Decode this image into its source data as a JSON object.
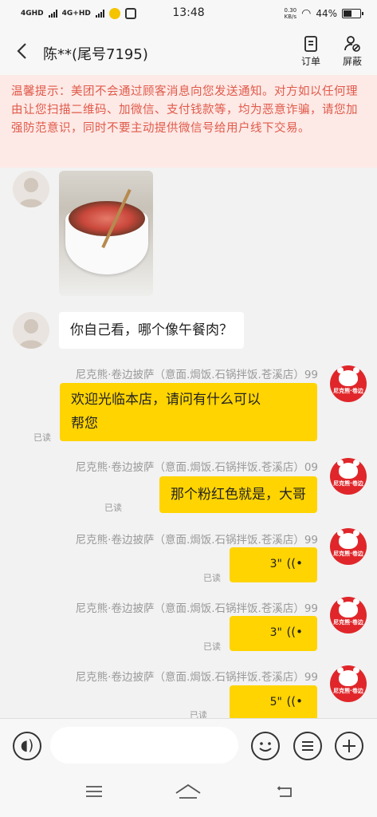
{
  "status_bar": {
    "network_1": "4GHD",
    "network_2": "4G+HD",
    "time": "13:48",
    "speed_value": "0.30",
    "speed_unit": "KB/s",
    "battery": "44%"
  },
  "header": {
    "title": "陈**(尾号7195)",
    "orders_label": "订单",
    "block_label": "屏蔽"
  },
  "warning": "温馨提示：美团不会通过顾客消息向您发送通知。对方如以任何理由让您扫描二维码、加微信、支付钱款等，均为恶意诈骗，请您加强防范意识，同时不要主动提供微信号给用户线下交易。",
  "messages": [
    {
      "from": "customer",
      "type": "image"
    },
    {
      "from": "customer",
      "type": "text",
      "text": "你自己看，哪个像午餐肉？"
    },
    {
      "from": "shop",
      "sender": "尼克熊·卷边披萨（意面.焗饭.石锅拌饭.苍溪店）99",
      "type": "text",
      "text_line1": "欢迎光临本店，请问有什么可以",
      "text_line2": "帮您",
      "status": "已读"
    },
    {
      "from": "shop",
      "sender": "尼克熊·卷边披萨（意面.焗饭.石锅拌饭.苍溪店）09",
      "type": "text",
      "text": "那个粉红色就是，大哥",
      "status": "已读"
    },
    {
      "from": "shop",
      "sender": "尼克熊·卷边披萨（意面.焗饭.石锅拌饭.苍溪店）99",
      "type": "voice",
      "duration": "3\"",
      "status": "已读"
    },
    {
      "from": "shop",
      "sender": "尼克熊·卷边披萨（意面.焗饭.石锅拌饭.苍溪店）99",
      "type": "voice",
      "duration": "3\"",
      "status": "已读"
    },
    {
      "from": "shop",
      "sender": "尼克熊·卷边披萨（意面.焗饭.石锅拌饭.苍溪店）99",
      "type": "voice",
      "duration": "5\"",
      "status": "已读"
    }
  ],
  "shop_avatar_text": "尼克熊·卷边",
  "input": {
    "placeholder": ""
  },
  "icons": {
    "back": "chevron-left-icon",
    "orders": "document-icon",
    "block": "user-block-icon",
    "voice": "voice-input-icon",
    "emoji": "emoji-icon",
    "quick_reply": "list-icon",
    "more": "plus-icon"
  },
  "colors": {
    "accent_yellow": "#ffd400",
    "warning_text": "#e05a4a",
    "warning_bg": "#fde9e6",
    "shop_avatar_red": "#e0262a"
  }
}
